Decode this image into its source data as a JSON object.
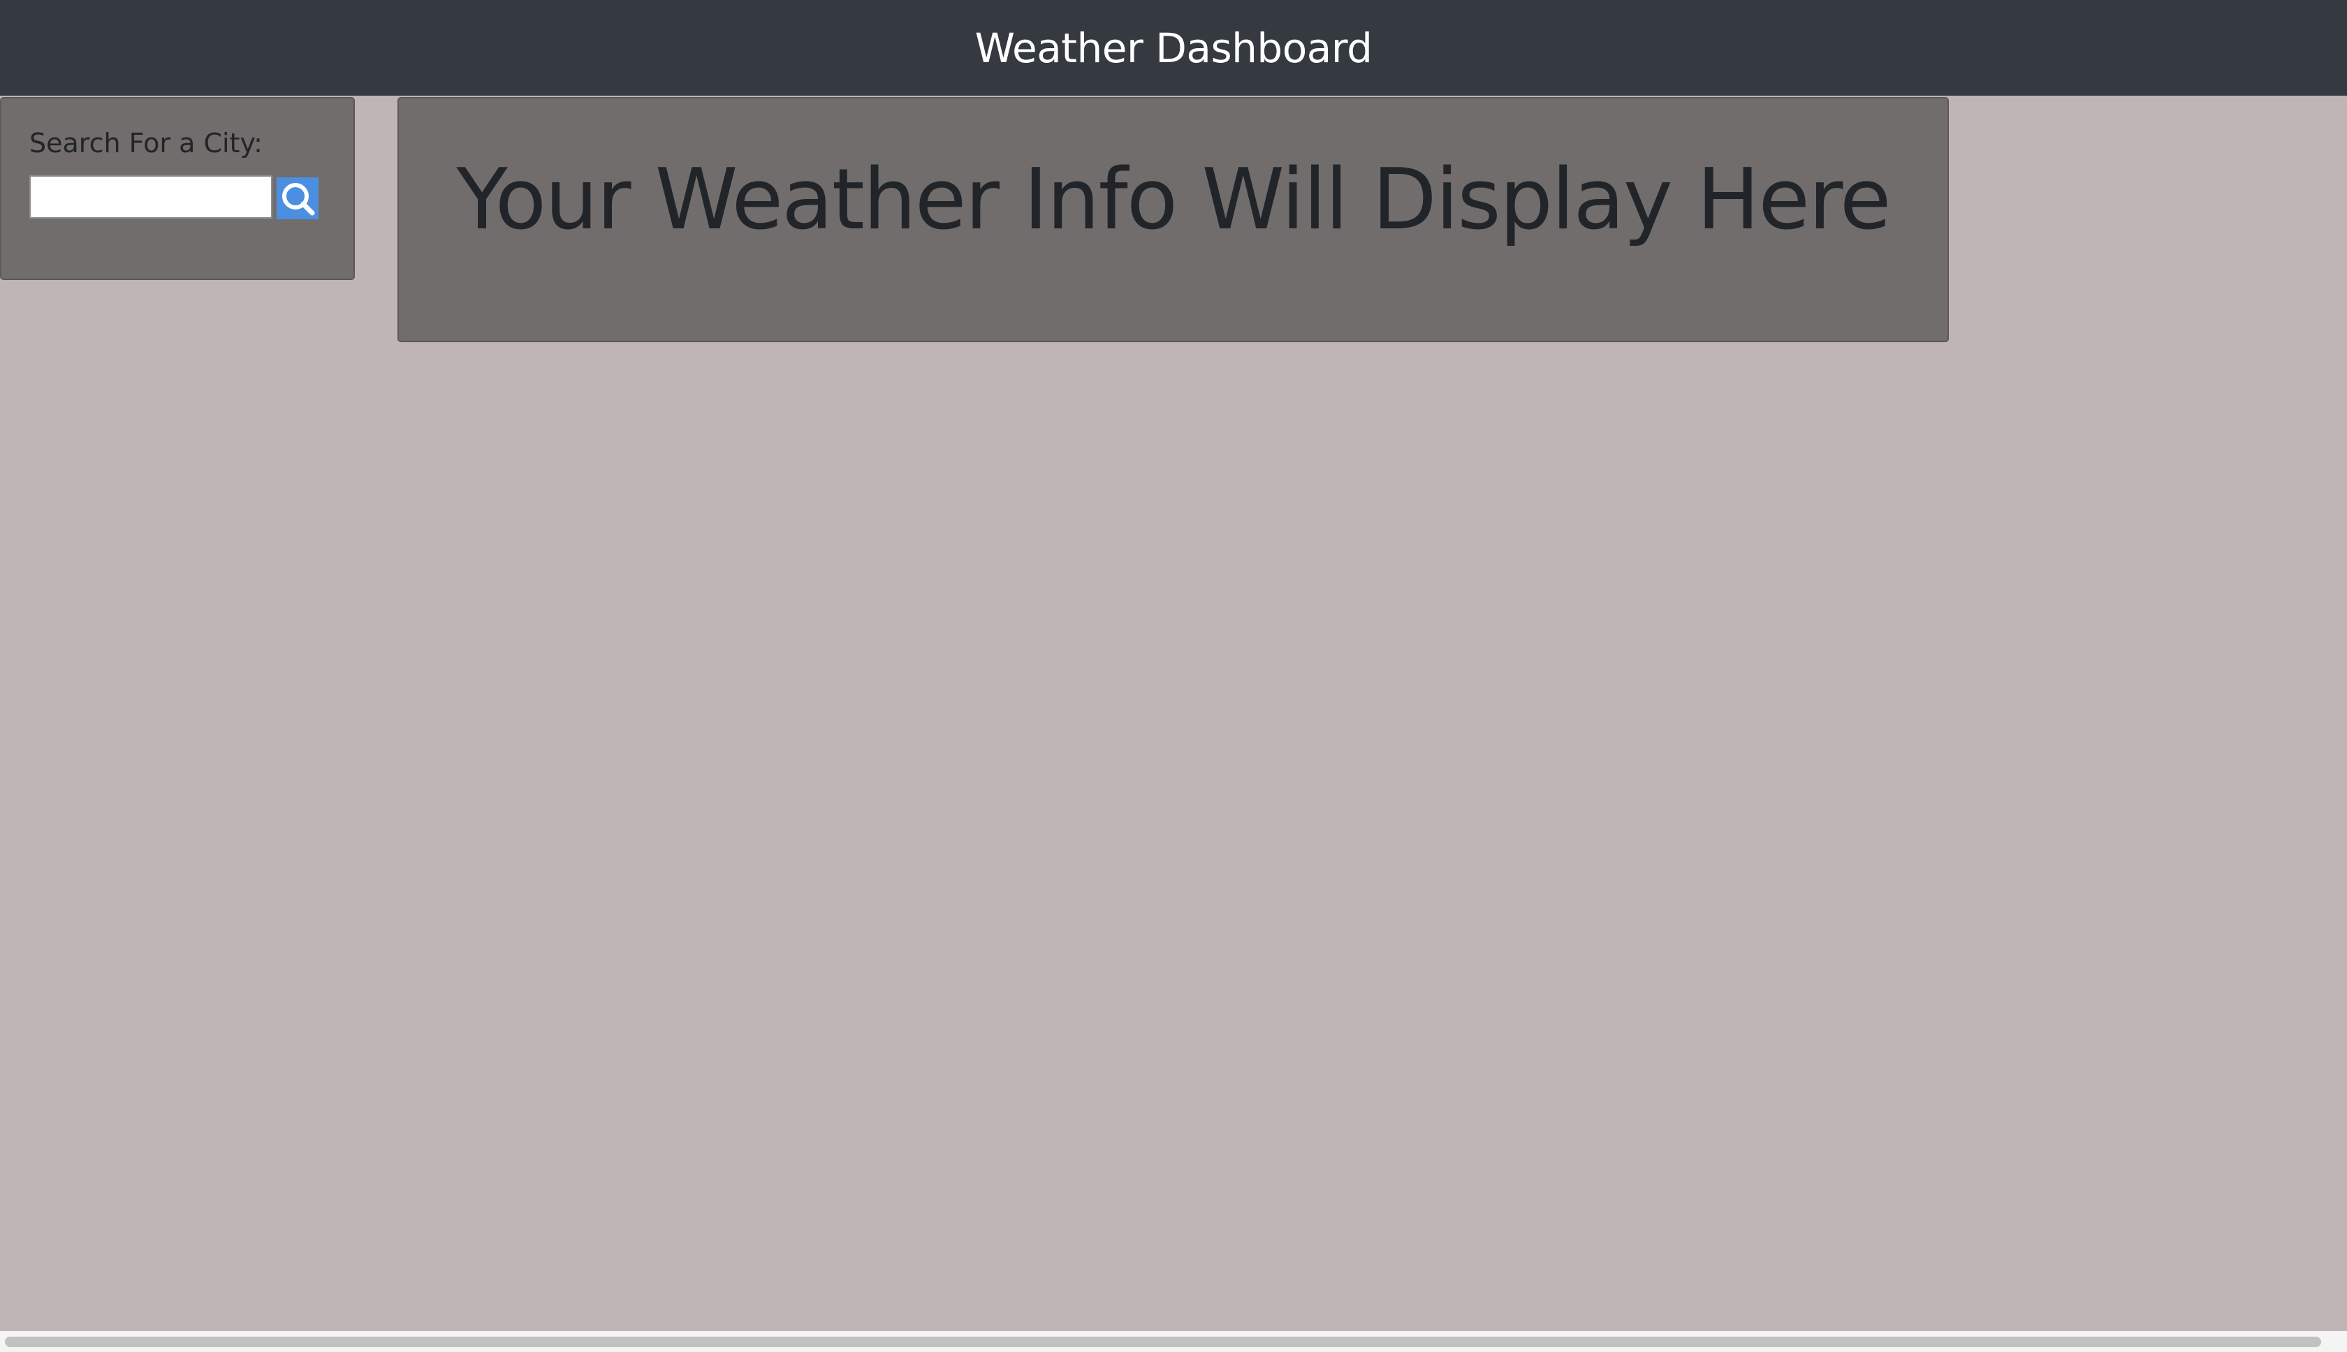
{
  "header": {
    "title": "Weather Dashboard"
  },
  "search": {
    "label": "Search For a City:",
    "input_value": "",
    "placeholder": "",
    "button_icon": "search-icon",
    "button_color": "#4c8fe0"
  },
  "main": {
    "placeholder_text": "Your Weather Info Will Display Here"
  },
  "colors": {
    "header_bg": "#343a40",
    "page_bg": "#bfb5b4",
    "panel_bg": "#716d6c",
    "text_dark": "#212529"
  }
}
